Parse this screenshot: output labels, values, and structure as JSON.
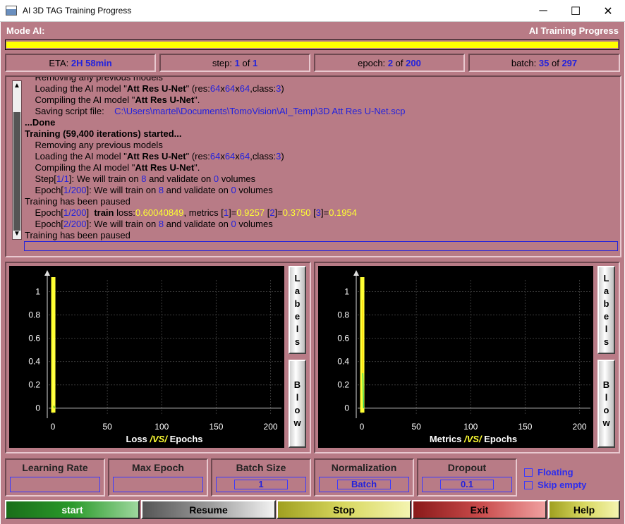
{
  "window": {
    "title": "AI 3D TAG Training Progress",
    "minimize": "─",
    "maximize": "☐",
    "close": "✕"
  },
  "header": {
    "mode_label": "Mode AI:",
    "progress_title": "AI Training Progress",
    "overall_progress": 1.0,
    "bar_color": "#ffff00"
  },
  "status": {
    "eta_label": "ETA:",
    "eta_value": "2H 58min",
    "step_label": "step:",
    "step_current": "1",
    "step_total": "1",
    "epoch_label": "epoch:",
    "epoch_current": "2",
    "epoch_total": "200",
    "batch_label": "batch:",
    "batch_current": "35",
    "batch_total": "297",
    "of": "of"
  },
  "log": {
    "lines": [
      [
        {
          "t": "    Removing any previous models"
        }
      ],
      [
        {
          "t": "    Loading the AI model \""
        },
        {
          "t": "Att Res U-Net",
          "s": "b"
        },
        {
          "t": "\" (res:"
        },
        {
          "t": "64",
          "s": "blue"
        },
        {
          "t": "x"
        },
        {
          "t": "64",
          "s": "blue"
        },
        {
          "t": "x"
        },
        {
          "t": "64",
          "s": "blue"
        },
        {
          "t": ",class:"
        },
        {
          "t": "3",
          "s": "blue"
        },
        {
          "t": ")"
        }
      ],
      [
        {
          "t": "    Compiling the AI model \""
        },
        {
          "t": "Att Res U-Net",
          "s": "b"
        },
        {
          "t": "\"."
        }
      ],
      [
        {
          "t": "    Saving script file:    "
        },
        {
          "t": "C:\\Users\\martel\\Documents\\TomoVision\\AI_Temp\\3D Att Res U-Net.scp",
          "s": "blue"
        }
      ],
      [
        {
          "t": "...Done",
          "s": "b"
        }
      ],
      [
        {
          "t": "Training (59,400 iterations) started...",
          "s": "b"
        }
      ],
      [
        {
          "t": "    Removing any previous models"
        }
      ],
      [
        {
          "t": "    Loading the AI model \""
        },
        {
          "t": "Att Res U-Net",
          "s": "b"
        },
        {
          "t": "\" (res:"
        },
        {
          "t": "64",
          "s": "blue"
        },
        {
          "t": "x"
        },
        {
          "t": "64",
          "s": "blue"
        },
        {
          "t": "x"
        },
        {
          "t": "64",
          "s": "blue"
        },
        {
          "t": ",class:"
        },
        {
          "t": "3",
          "s": "blue"
        },
        {
          "t": ")"
        }
      ],
      [
        {
          "t": "    Compiling the AI model \""
        },
        {
          "t": "Att Res U-Net",
          "s": "b"
        },
        {
          "t": "\"."
        }
      ],
      [
        {
          "t": "    Step["
        },
        {
          "t": "1/1",
          "s": "blue"
        },
        {
          "t": "]: We will train on "
        },
        {
          "t": "8",
          "s": "blue"
        },
        {
          "t": " and validate on "
        },
        {
          "t": "0",
          "s": "blue"
        },
        {
          "t": " volumes"
        }
      ],
      [
        {
          "t": "    Epoch["
        },
        {
          "t": "1/200",
          "s": "blue"
        },
        {
          "t": "]: We will train on "
        },
        {
          "t": "8",
          "s": "blue"
        },
        {
          "t": " and validate on "
        },
        {
          "t": "0",
          "s": "blue"
        },
        {
          "t": " volumes"
        }
      ],
      [
        {
          "t": "Training has been paused"
        }
      ],
      [
        {
          "t": "    Epoch["
        },
        {
          "t": "1/200",
          "s": "blue"
        },
        {
          "t": "]  "
        },
        {
          "t": "train",
          "s": "b"
        },
        {
          "t": " loss:"
        },
        {
          "t": "0.60040849",
          "s": "yel"
        },
        {
          "t": ", metrics ["
        },
        {
          "t": "1",
          "s": "blue"
        },
        {
          "t": "]="
        },
        {
          "t": "0.9257",
          "s": "yel"
        },
        {
          "t": " ["
        },
        {
          "t": "2",
          "s": "blue"
        },
        {
          "t": "]="
        },
        {
          "t": "0.3750",
          "s": "yel"
        },
        {
          "t": " ["
        },
        {
          "t": "3",
          "s": "blue"
        },
        {
          "t": "]="
        },
        {
          "t": "0.1954",
          "s": "yel"
        }
      ],
      [
        {
          "t": "    Epoch["
        },
        {
          "t": "2/200",
          "s": "blue"
        },
        {
          "t": "]: We will train on "
        },
        {
          "t": "8",
          "s": "blue"
        },
        {
          "t": " and validate on "
        },
        {
          "t": "0",
          "s": "blue"
        },
        {
          "t": " volumes"
        }
      ],
      [
        {
          "t": "Training has been paused"
        }
      ]
    ],
    "scroll_up": "▲",
    "scroll_down": "▼"
  },
  "chart_data": [
    {
      "type": "line",
      "xlabel": [
        "Loss",
        "/VS/",
        "Epochs"
      ],
      "x_ticks": [
        "0",
        "50",
        "100",
        "150",
        "200"
      ],
      "y_ticks": [
        "0",
        "0.2",
        "0.4",
        "0.6",
        "0.8",
        "1"
      ],
      "xlim": [
        0,
        210
      ],
      "ylim": [
        -0.05,
        1.1
      ],
      "current_epoch": 1,
      "marker_color": "#ffff33",
      "series": [
        {
          "color": "#ffff66",
          "x": [
            0.7,
            0.7
          ],
          "y": [
            0.6,
            0.0
          ]
        },
        {
          "color": "#00aa00",
          "x": [
            0.9,
            1.2
          ],
          "y": [
            0.02,
            0.0
          ]
        }
      ],
      "grid": true,
      "side_buttons": [
        "Labels",
        "Blow"
      ]
    },
    {
      "type": "line",
      "xlabel": [
        "Metrics",
        "/VS/",
        "Epochs"
      ],
      "x_ticks": [
        "0",
        "50",
        "100",
        "150",
        "200"
      ],
      "y_ticks": [
        "0",
        "0.2",
        "0.4",
        "0.6",
        "0.8",
        "1"
      ],
      "xlim": [
        0,
        210
      ],
      "ylim": [
        -0.05,
        1.1
      ],
      "current_epoch": 1,
      "marker_color": "#ffff33",
      "series": [
        {
          "color": "#ffcc00",
          "x": [
            0.7,
            0.8
          ],
          "y": [
            0.93,
            0.3
          ]
        },
        {
          "color": "#00cc66",
          "x": [
            0.9,
            1.5
          ],
          "y": [
            0.3,
            0.0
          ]
        }
      ],
      "grid": true,
      "side_buttons": [
        "Labels",
        "Blow"
      ]
    }
  ],
  "params": {
    "learning_rate": {
      "label": "Learning Rate",
      "value": ""
    },
    "max_epoch": {
      "label": "Max Epoch",
      "value": ""
    },
    "batch_size": {
      "label": "Batch Size",
      "value": "1"
    },
    "normalization": {
      "label": "Normalization",
      "value": "Batch"
    },
    "dropout": {
      "label": "Dropout",
      "value": "0.1"
    }
  },
  "options": {
    "floating": "Floating",
    "skip_empty": "Skip empty"
  },
  "buttons": {
    "start": "start",
    "resume": "Resume",
    "stop": "Stop",
    "exit": "Exit",
    "help": "Help"
  }
}
